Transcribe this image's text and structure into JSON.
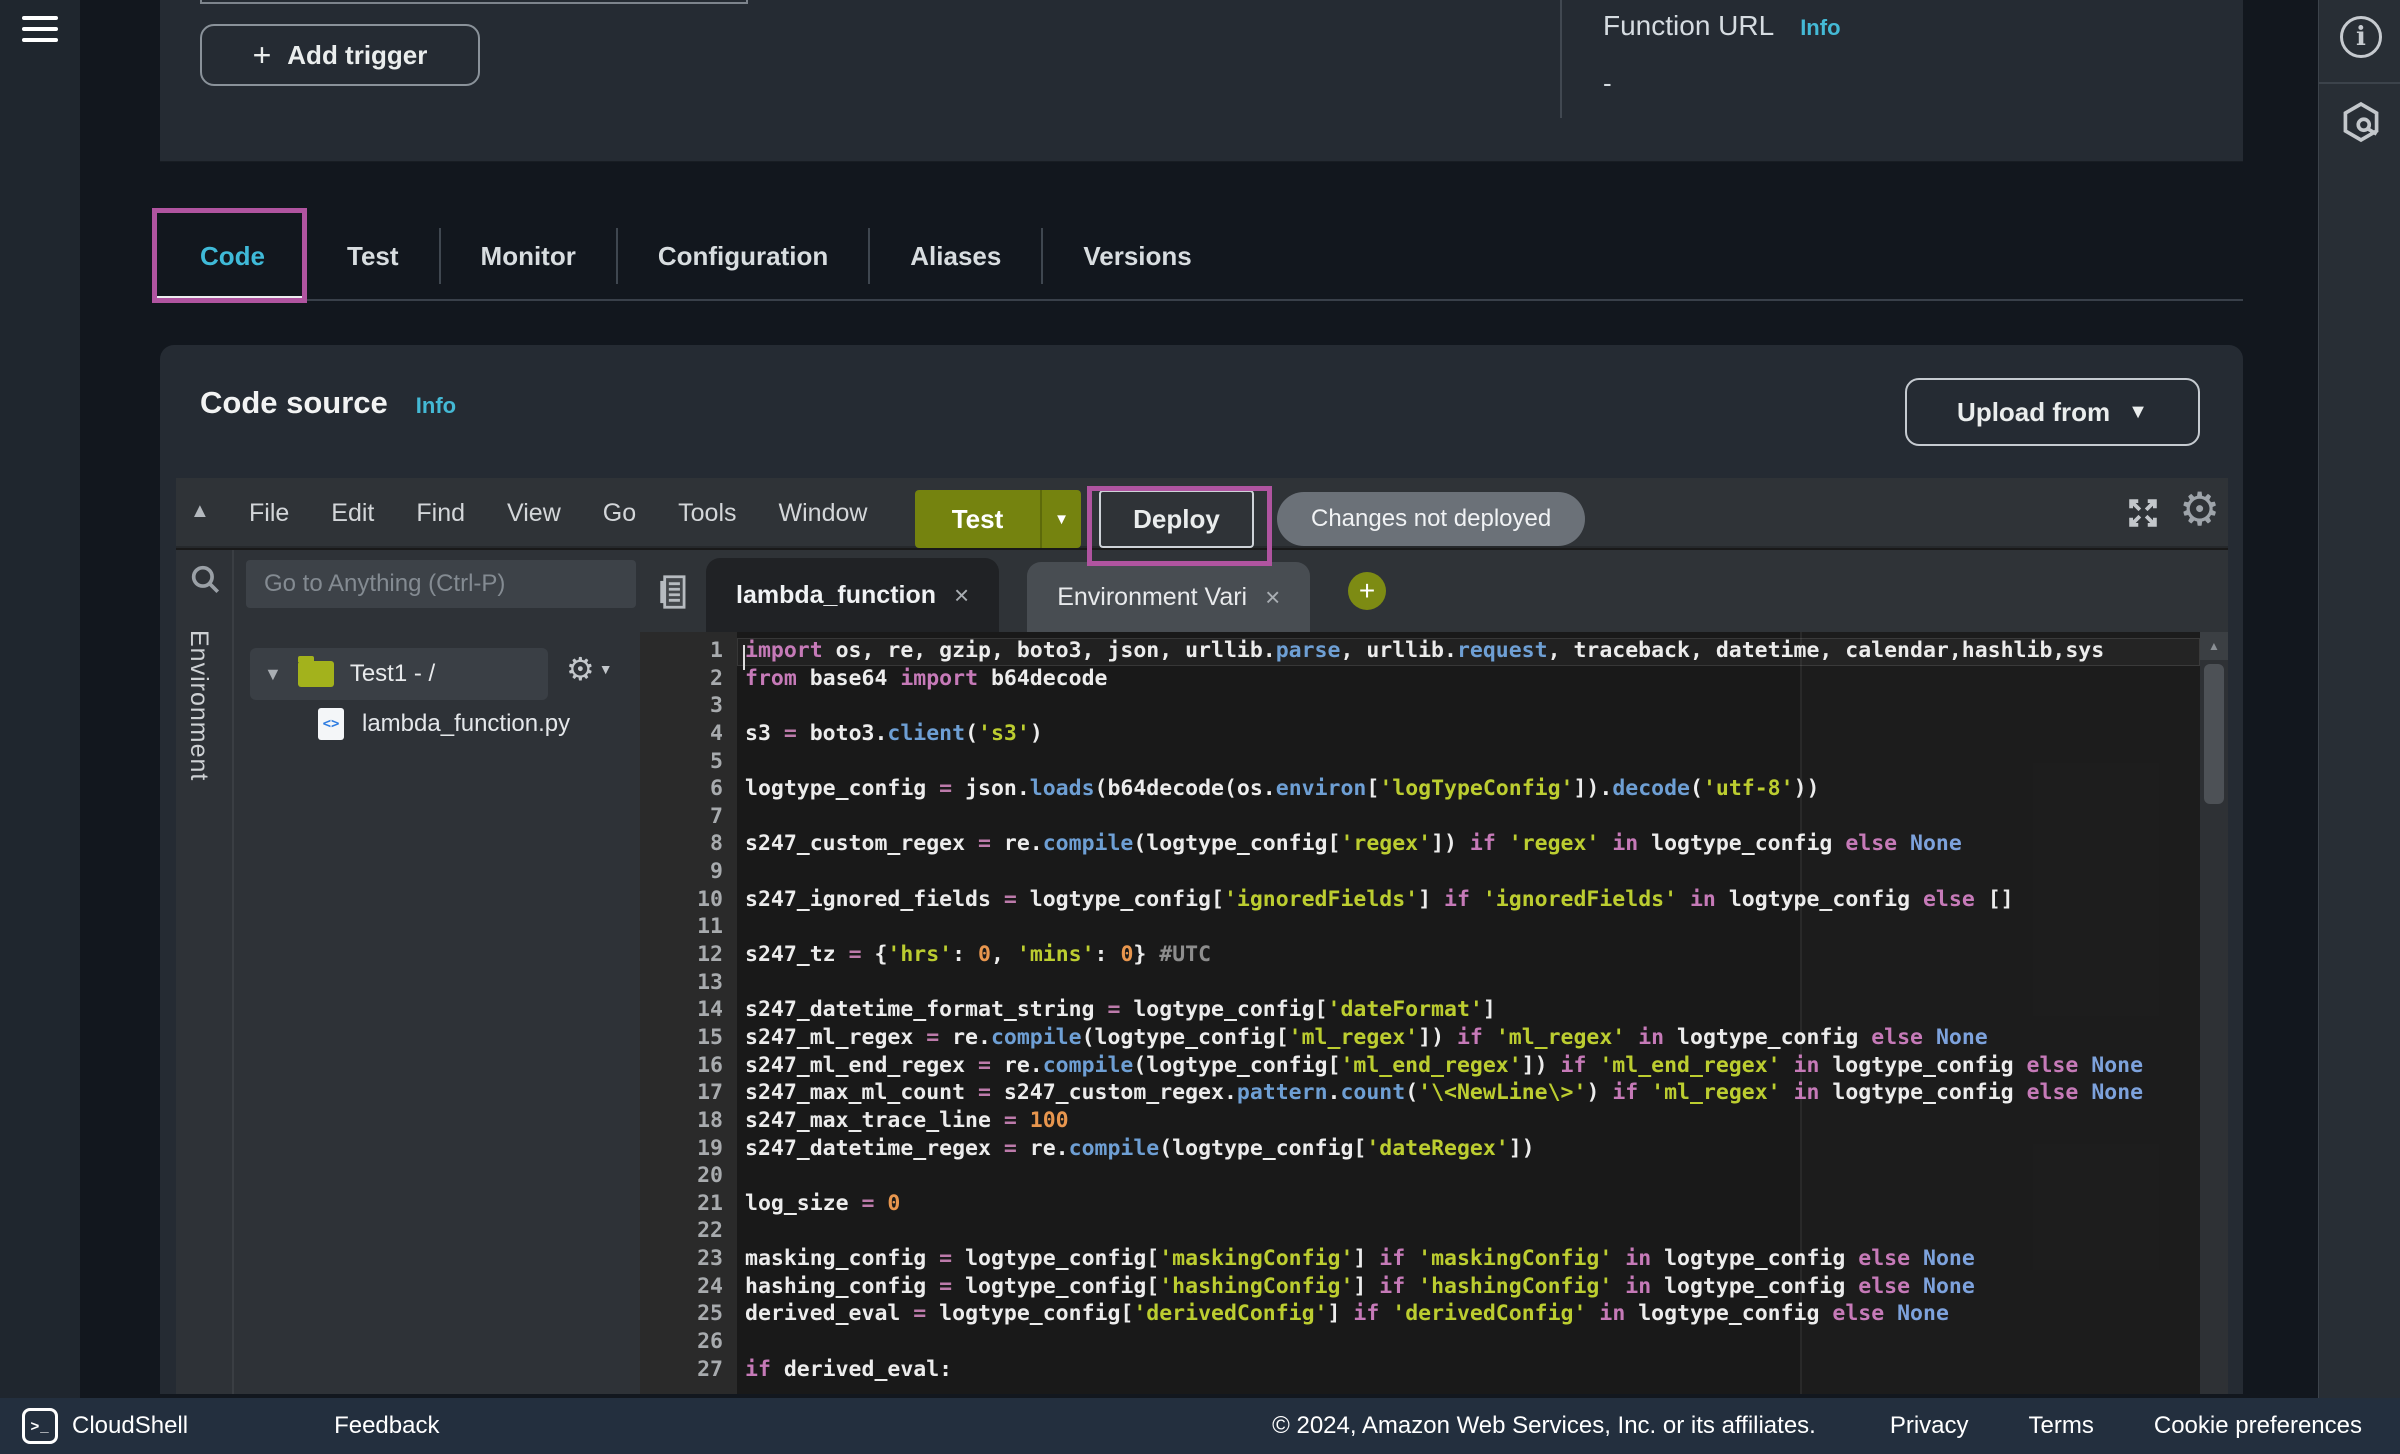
{
  "colors": {
    "annotation_magenta": "#b054a0",
    "link_cyan": "#44b9d5",
    "test_button_green": "#75830f",
    "string_lime": "#bccd30",
    "panel_bg": "#252b33",
    "editor_bg": "#191919",
    "footer_navy": "#232f3e"
  },
  "top_panel": {
    "add_trigger_label": "Add trigger",
    "function_url_label": "Function URL",
    "info_label": "Info",
    "function_url_value": "-"
  },
  "function_tabs": {
    "items": [
      {
        "label": "Code",
        "active": true
      },
      {
        "label": "Test",
        "active": false
      },
      {
        "label": "Monitor",
        "active": false
      },
      {
        "label": "Configuration",
        "active": false
      },
      {
        "label": "Aliases",
        "active": false
      },
      {
        "label": "Versions",
        "active": false
      }
    ]
  },
  "code_source": {
    "title": "Code source",
    "info_label": "Info",
    "upload_button": "Upload from"
  },
  "editor": {
    "menus": [
      "File",
      "Edit",
      "Find",
      "View",
      "Go",
      "Tools",
      "Window"
    ],
    "test_button": "Test",
    "deploy_button": "Deploy",
    "status_badge": "Changes not deployed",
    "search_placeholder": "Go to Anything (Ctrl-P)",
    "environment_label": "Environment",
    "tree": {
      "folder_label": "Test1 - /",
      "file_label": "lambda_function.py"
    },
    "tabs": [
      {
        "label": "lambda_function",
        "active": true
      },
      {
        "label": "Environment Vari",
        "active": false
      }
    ],
    "code": {
      "active_line": 1,
      "lines": [
        "import os, re, gzip, boto3, json, urllib.parse, urllib.request, traceback, datetime, calendar,hashlib,sys",
        "from base64 import b64decode",
        "",
        "s3 = boto3.client('s3')",
        "",
        "logtype_config = json.loads(b64decode(os.environ['logTypeConfig']).decode('utf-8'))",
        "",
        "s247_custom_regex = re.compile(logtype_config['regex']) if 'regex' in logtype_config else None",
        "",
        "s247_ignored_fields = logtype_config['ignoredFields'] if 'ignoredFields' in logtype_config else []",
        "",
        "s247_tz = {'hrs': 0, 'mins': 0} #UTC",
        "",
        "s247_datetime_format_string = logtype_config['dateFormat']",
        "s247_ml_regex = re.compile(logtype_config['ml_regex']) if 'ml_regex' in logtype_config else None",
        "s247_ml_end_regex = re.compile(logtype_config['ml_end_regex']) if 'ml_end_regex' in logtype_config else None",
        "s247_max_ml_count = s247_custom_regex.pattern.count('\\<NewLine\\>') if 'ml_regex' in logtype_config else None",
        "s247_max_trace_line = 100",
        "s247_datetime_regex = re.compile(logtype_config['dateRegex'])",
        "",
        "log_size = 0",
        "",
        "masking_config = logtype_config['maskingConfig'] if 'maskingConfig' in logtype_config else None",
        "hashing_config = logtype_config['hashingConfig'] if 'hashingConfig' in logtype_config else None",
        "derived_eval = logtype_config['derivedConfig'] if 'derivedConfig' in logtype_config else None",
        "",
        "if derived_eval:"
      ]
    }
  },
  "footer": {
    "cloudshell_label": "CloudShell",
    "feedback_label": "Feedback",
    "copyright": "© 2024, Amazon Web Services, Inc. or its affiliates.",
    "links": [
      "Privacy",
      "Terms",
      "Cookie preferences"
    ]
  }
}
